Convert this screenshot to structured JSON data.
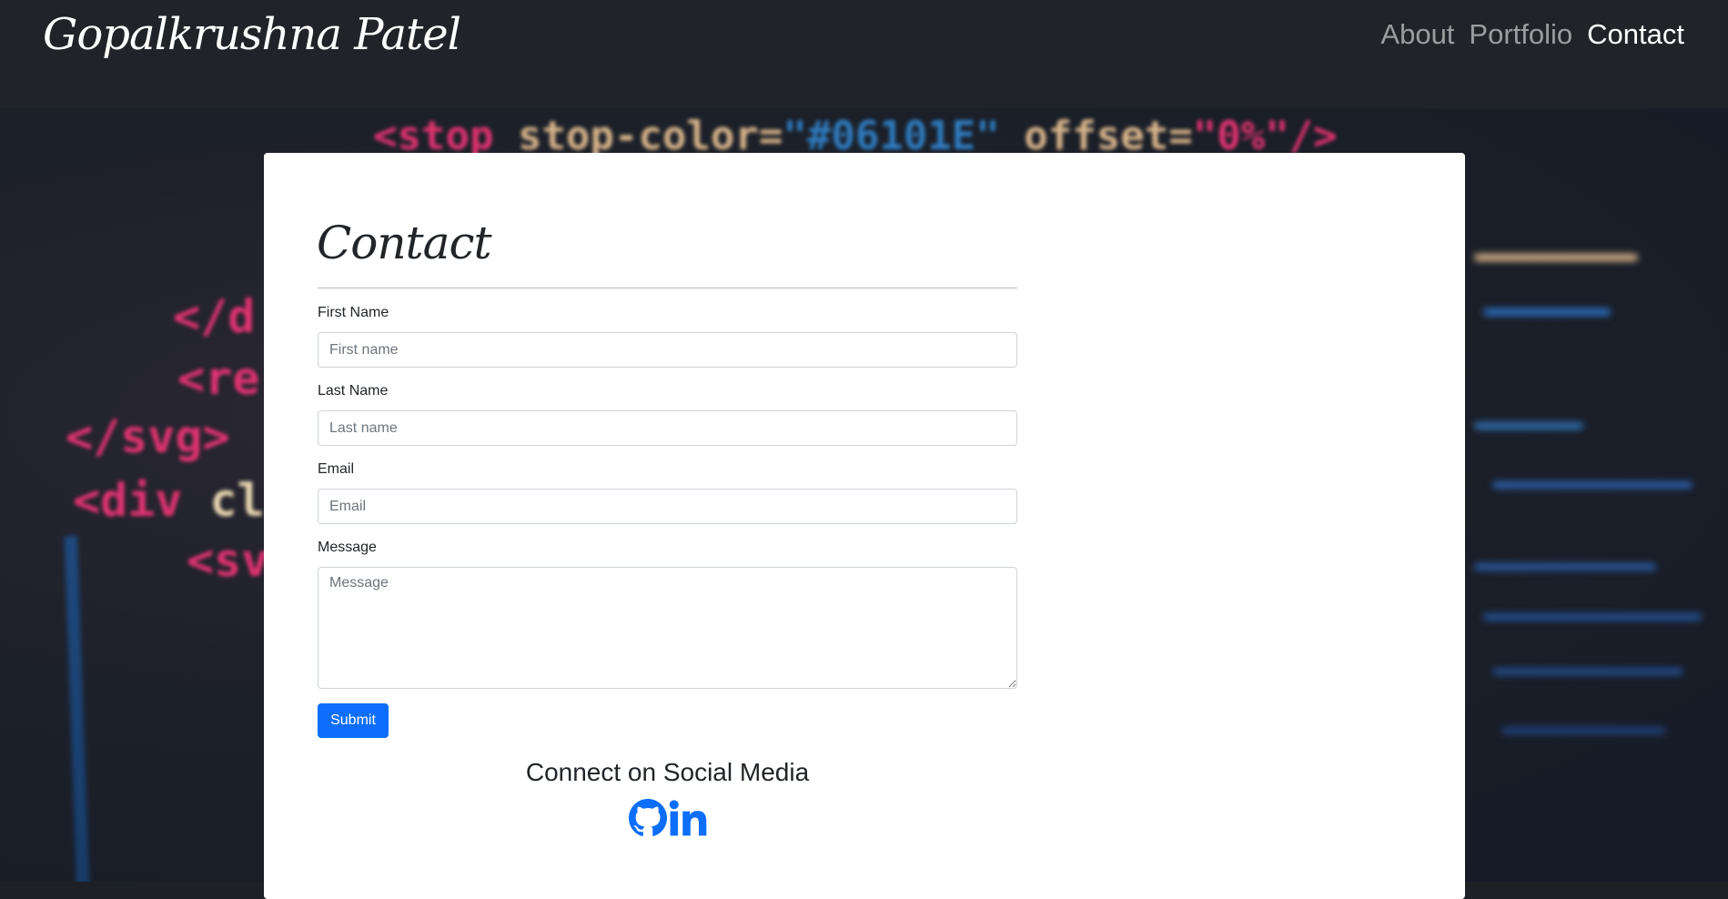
{
  "navbar": {
    "brand": "Gopalkrushna Patel",
    "links": [
      {
        "label": "About",
        "active": false
      },
      {
        "label": "Portfolio",
        "active": false
      },
      {
        "label": "Contact",
        "active": true
      }
    ]
  },
  "background_code": {
    "line1": {
      "tag": "<stop",
      "attr": "stop-color=",
      "value": "\"#06101E\"",
      "attr2": "offset=",
      "value2": "\"0%\"/>"
    },
    "line2": "</d",
    "line3": "<re",
    "line4": "</svg>",
    "line5a": "<div",
    "line5b": "cl",
    "line6": "<sv"
  },
  "contact": {
    "title": "Contact",
    "fields": {
      "first_name": {
        "label": "First Name",
        "placeholder": "First name",
        "value": ""
      },
      "last_name": {
        "label": "Last Name",
        "placeholder": "Last name",
        "value": ""
      },
      "email": {
        "label": "Email",
        "placeholder": "Email",
        "value": ""
      },
      "message": {
        "label": "Message",
        "placeholder": "Message",
        "value": ""
      }
    },
    "submit_label": "Submit"
  },
  "social": {
    "heading": "Connect on Social Media",
    "icons": [
      "github-icon",
      "linkedin-icon"
    ],
    "icon_color": "#0d6efd"
  },
  "colors": {
    "navbar_bg": "#202428",
    "accent": "#0d6efd",
    "card_bg": "#ffffff"
  }
}
